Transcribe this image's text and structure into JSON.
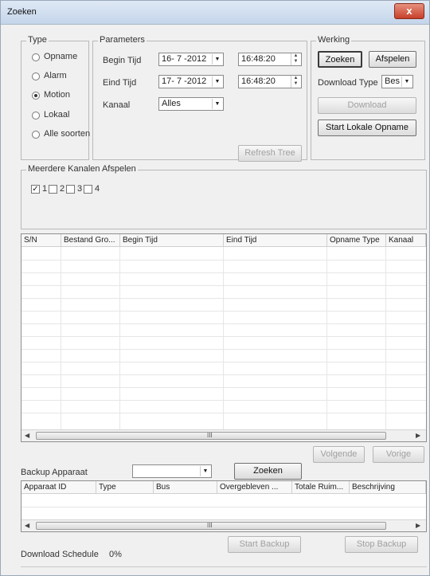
{
  "window": {
    "title": "Zoeken",
    "close_glyph": "x"
  },
  "type_group": {
    "legend": "Type",
    "options": [
      {
        "label": "Opname",
        "selected": false
      },
      {
        "label": "Alarm",
        "selected": false
      },
      {
        "label": "Motion",
        "selected": true
      },
      {
        "label": "Lokaal",
        "selected": false
      },
      {
        "label": "Alle soorten",
        "selected": false
      }
    ]
  },
  "params_group": {
    "legend": "Parameters",
    "begin_label": "Begin Tijd",
    "begin_date": "16- 7 -2012",
    "begin_time": "16:48:20",
    "end_label": "Eind Tijd",
    "end_date": "17- 7 -2012",
    "end_time": "16:48:20",
    "channel_label": "Kanaal",
    "channel_value": "Alles",
    "refresh_button": "Refresh Tree"
  },
  "work_group": {
    "legend": "Werking",
    "search_button": "Zoeken",
    "cancel_button": "Afspelen",
    "download_type_label": "Download Type",
    "download_type_value": "Bes",
    "download_button": "Download",
    "local_rec_button": "Start Lokale Opname"
  },
  "channels_group": {
    "legend": "Meerdere Kanalen Afspelen",
    "channels": [
      {
        "label": "1",
        "checked": true
      },
      {
        "label": "2",
        "checked": false
      },
      {
        "label": "3",
        "checked": false
      },
      {
        "label": "4",
        "checked": false
      }
    ]
  },
  "results_table": {
    "columns": [
      "S/N",
      "Bestand Gro...",
      "Begin Tijd",
      "Eind Tijd",
      "Opname Type",
      "Kanaal"
    ]
  },
  "pager": {
    "next_button": "Volgende",
    "prev_button": "Vorige"
  },
  "backup": {
    "device_label": "Backup Apparaat",
    "device_value": "",
    "search_button": "Zoeken",
    "columns": [
      "Apparaat ID",
      "Type",
      "Bus",
      "Overgebleven ...",
      "Totale Ruim...",
      "Beschrijving"
    ],
    "start_button": "Start Backup",
    "stop_button": "Stop Backup"
  },
  "status": {
    "label": "Download Schedule",
    "value": "0%"
  },
  "scroll": {
    "left_arrow": "◀",
    "right_arrow": "▶",
    "grip": "III"
  },
  "icons": {
    "dropdown": "▼",
    "spin_up": "▲",
    "spin_down": "▼",
    "check": "✓"
  }
}
